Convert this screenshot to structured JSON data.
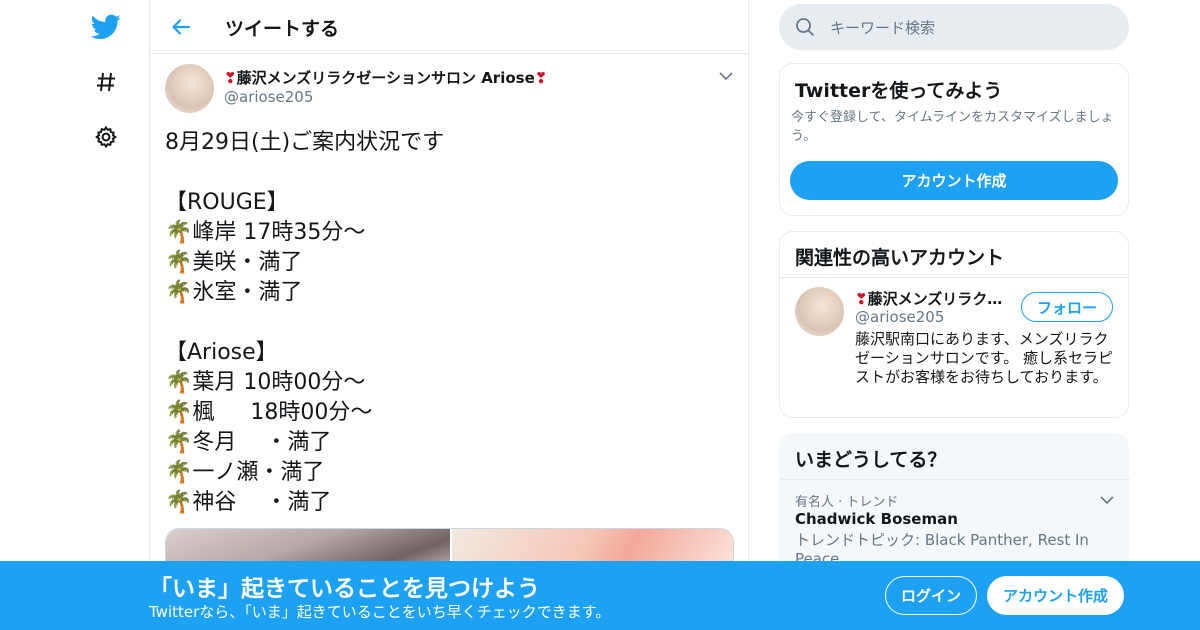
{
  "colors": {
    "brand": "#1da1f2",
    "text_primary": "#14171a",
    "text_secondary": "#657786",
    "border": "#e6ecf0"
  },
  "nav": {
    "items": [
      "twitter-logo-icon",
      "hashtag-icon",
      "gear-icon"
    ]
  },
  "header": {
    "title": "ツイートする",
    "back_icon": "arrow-left-icon"
  },
  "tweet": {
    "author": {
      "name_emoji_left": "❣",
      "name": "藤沢メンズリラクゼーションサロン Ariose",
      "name_emoji_right": "❣",
      "handle": "@ariose205"
    },
    "text": "8月29日(土)ご案内状況です\n\n【ROUGE】\n🌴峰岸 17時35分～\n🌴美咲・満了\n🌴氷室・満了\n\n【Ariose】\n🌴葉月 10時00分～\n🌴楓　  18時00分～\n🌴冬月　 ・満了\n🌴一ノ瀬・満了\n🌴神谷　 ・満了"
  },
  "search": {
    "placeholder": "キーワード検索"
  },
  "signup_card": {
    "title": "Twitterを使ってみよう",
    "description": "今すぐ登録して、タイムラインをカスタマイズしましょう。",
    "button_label": "アカウント作成"
  },
  "related_card": {
    "title": "関連性の高いアカウント",
    "account": {
      "name_emoji": "❣",
      "name": "藤沢メンズリラク…",
      "handle": "@ariose205",
      "follow_label": "フォロー",
      "bio": "藤沢駅南口にあります、メンズリラクゼーションサロンです。 癒し系セラピストがお客様をお待ちしております。"
    }
  },
  "trends_card": {
    "title": "いまどうしてる？",
    "trend": {
      "meta": "有名人 · トレンド",
      "name": "Chadwick Boseman",
      "topic": "トレンドトピック: Black Panther, Rest In Peace"
    }
  },
  "bottom_bar": {
    "title": "「いま」起きていることを見つけよう",
    "subtitle": "Twitterなら、「いま」起きていることをいち早くチェックできます。",
    "login_label": "ログイン",
    "signup_label": "アカウント作成"
  }
}
